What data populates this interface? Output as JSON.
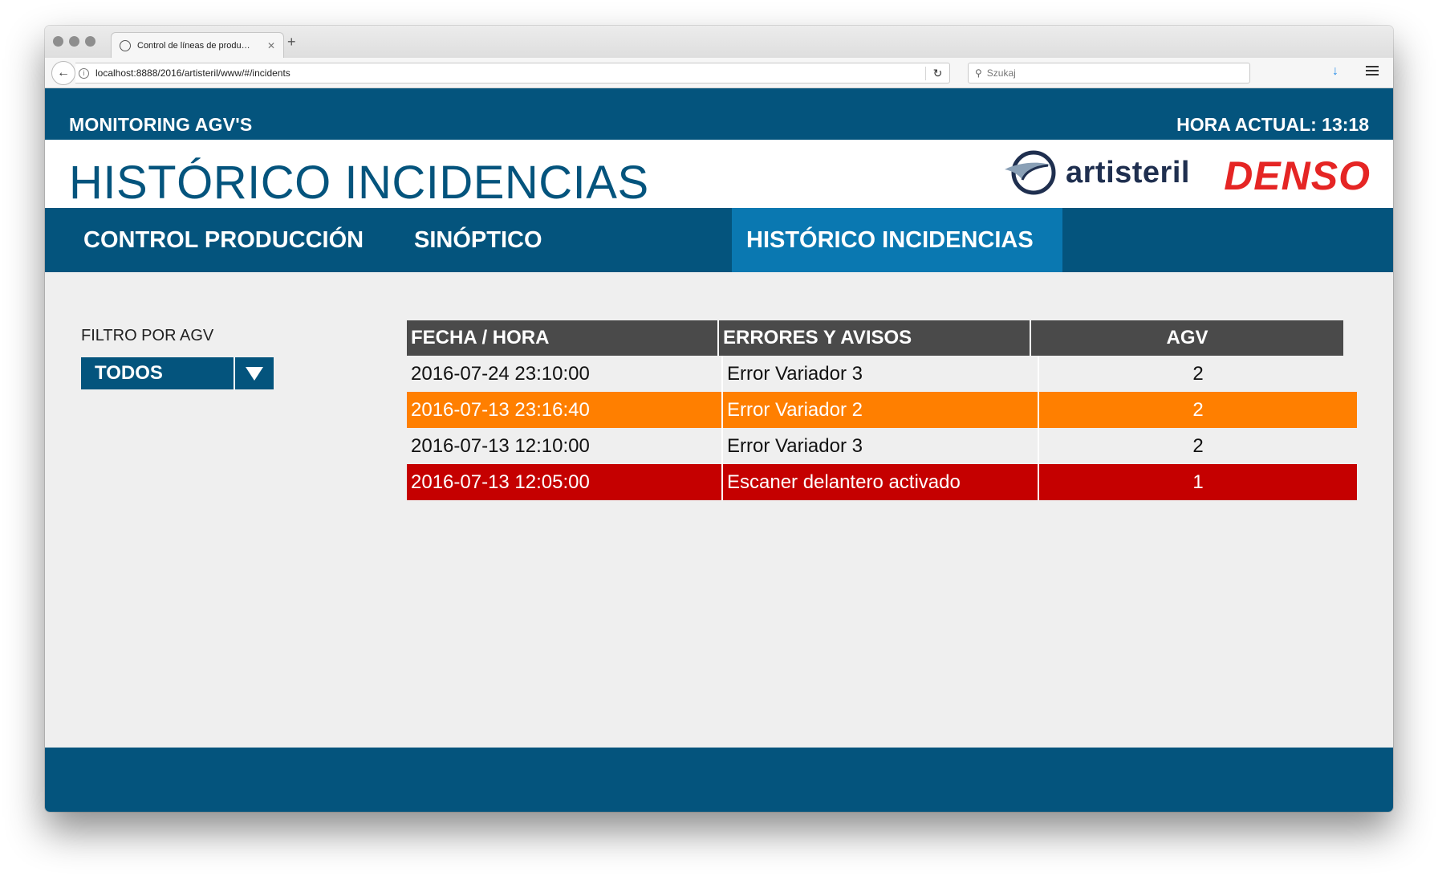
{
  "browser": {
    "tab_title": "Control de líneas de produ…",
    "tab_close": "✕",
    "new_tab": "+",
    "url": "localhost:8888/2016/artisteril/www/#/incidents",
    "search_placeholder": "Szukaj"
  },
  "header": {
    "app_name": "MONITORING AGV'S",
    "clock": "HORA ACTUAL: 13:18",
    "page_title": "HISTÓRICO INCIDENCIAS",
    "logo_artisteril": "artisteril",
    "logo_denso": "DENSO"
  },
  "nav": {
    "tabs": [
      {
        "label": "CONTROL PRODUCCIÓN"
      },
      {
        "label": "SINÓPTICO"
      },
      {
        "label": "HISTÓRICO INCIDENCIAS"
      }
    ],
    "active_tab": "HISTÓRICO INCIDENCIAS"
  },
  "filter": {
    "label": "FILTRO POR AGV",
    "selected": "TODOS"
  },
  "table": {
    "columns": [
      "FECHA / HORA",
      "ERRORES Y AVISOS",
      "AGV"
    ],
    "rows": [
      {
        "fecha": "2016-07-24 23:10:00",
        "error": "Error Variador 3",
        "agv": "2",
        "status": "normal"
      },
      {
        "fecha": "2016-07-13 23:16:40",
        "error": "Error Variador 2",
        "agv": "2",
        "status": "warning"
      },
      {
        "fecha": "2016-07-13 12:10:00",
        "error": "Error Variador 3",
        "agv": "2",
        "status": "normal"
      },
      {
        "fecha": "2016-07-13 12:05:00",
        "error": "Escaner delantero activado",
        "agv": "1",
        "status": "alarm"
      }
    ]
  },
  "colors": {
    "brand_blue": "#04547d",
    "active_tab": "#0a78b1",
    "warning": "#ff7f00",
    "alarm": "#c50000",
    "logo_red": "#e52524"
  },
  "icons": {
    "back": "arrow-left-icon",
    "info": "info-icon",
    "reload": "reload-icon",
    "search": "search-icon",
    "download": "download-icon",
    "menu": "hamburger-menu-icon",
    "filter_arrow": "caret-down-icon"
  }
}
